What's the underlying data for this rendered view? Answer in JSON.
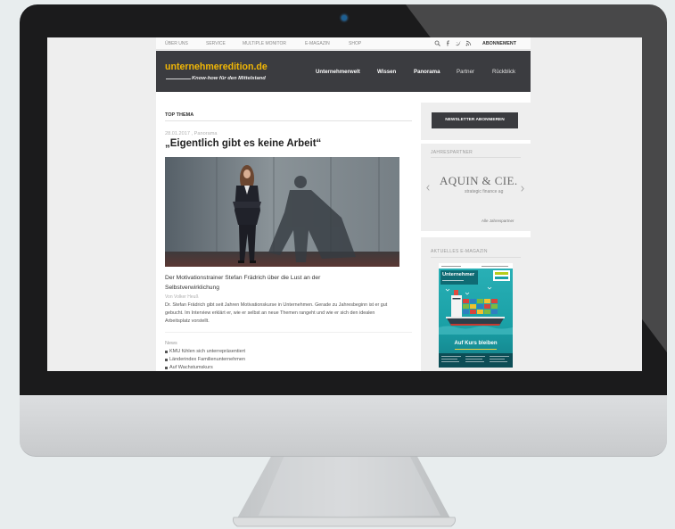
{
  "colors": {
    "background": "#e8edee",
    "bezel": "#1b1b1c",
    "header_bg": "#3b3c40",
    "logo": "#f2b705",
    "magazine_teal": "#1aa0a6"
  },
  "top_nav": {
    "links": [
      "ÜBER UNS",
      "SERVICE",
      "MULTIPLE MONITOR",
      "E-MAGAZIN",
      "SHOP"
    ],
    "icons": [
      "search-icon",
      "facebook-icon",
      "twitter-icon",
      "rss-icon"
    ],
    "subscribe_label": "ABONNEMENT"
  },
  "header": {
    "site_name": "unternehmeredition.de",
    "tagline": "Know-how für den Mittelstand",
    "nav": [
      "Unternehmerwelt",
      "Wissen",
      "Panorama",
      "Partner",
      "Rückblick"
    ]
  },
  "top_story": {
    "section_label": "TOP THEMA",
    "meta": "28.01.2017 , Panorama",
    "headline": "„Eigentlich gibt es keine Arbeit“",
    "teaser": "Der Motivationstrainer Stefan Frädrich über die Lust an der Selbstverwirklichung",
    "byline": "Von Volker Heuß",
    "body": "Dr. Stefan Frädrich gibt seit Jahren Motivationskurse in Unternehmen. Gerade zu Jahresbeginn ist er gut gebucht. Im Interview erklärt er, wie er selbst an neue Themen rangeht und wie er sich den idealen Arbeitsplatz vorstellt."
  },
  "news": {
    "heading": "News",
    "items": [
      "KMU fühlen sich unterrepräsentiert",
      "Länderindex Familienunternehmen",
      "Auf Wachstumskurs"
    ]
  },
  "sidebar": {
    "newsletter_button": "NEWSLETTER ABONNIEREN",
    "partners": {
      "heading": "JAHRESPARTNER",
      "logo_name": "AQUIN & CIE.",
      "logo_subline": "strategic finance ag",
      "all_link": "Alle Jahrespartner",
      "prev_icon": "chevron-left-icon",
      "next_icon": "chevron-right-icon"
    },
    "magazine": {
      "heading": "AKTUELLES E-MAGAZIN",
      "cover_title": "Unternehmer",
      "cover_headline": "Auf Kurs bleiben"
    }
  }
}
